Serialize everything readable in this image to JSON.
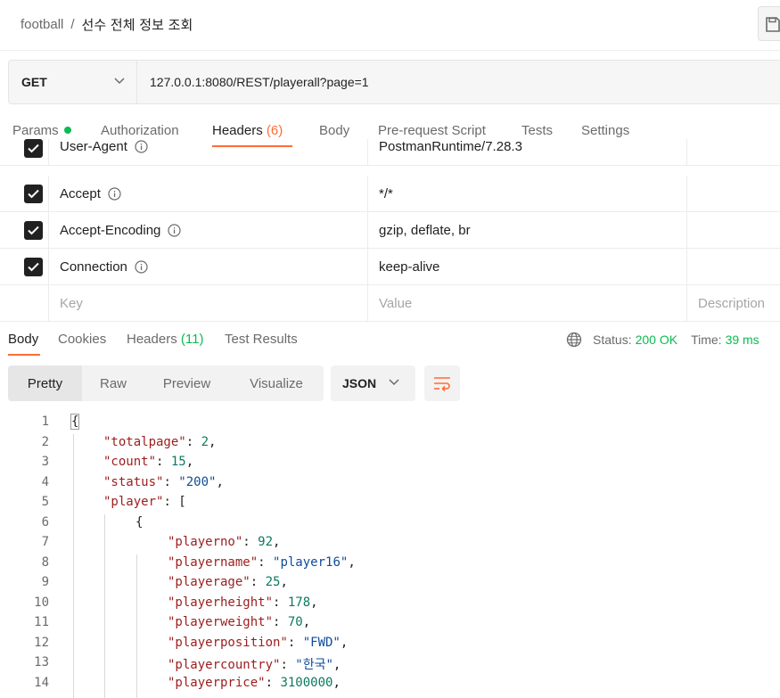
{
  "breadcrumb": {
    "collection": "football",
    "separator": "/",
    "request": "선수 전체 정보 조회"
  },
  "request": {
    "method": "GET",
    "url": "127.0.0.1:8080/REST/playerall?page=1"
  },
  "request_tabs": [
    {
      "label": "Params",
      "count": ""
    },
    {
      "label": "Authorization",
      "count": ""
    },
    {
      "label": "Headers",
      "count": "(6)"
    },
    {
      "label": "Body",
      "count": ""
    },
    {
      "label": "Pre-request Script",
      "count": ""
    },
    {
      "label": "Tests",
      "count": ""
    },
    {
      "label": "Settings",
      "count": ""
    }
  ],
  "headers": [
    {
      "key": "User-Agent",
      "value": "PostmanRuntime/7.28.3"
    },
    {
      "key": "Accept",
      "value": "*/*"
    },
    {
      "key": "Accept-Encoding",
      "value": "gzip, deflate, br"
    },
    {
      "key": "Connection",
      "value": "keep-alive"
    }
  ],
  "headers_placeholder": {
    "key": "Key",
    "value": "Value",
    "description": "Description"
  },
  "response_tabs": [
    {
      "label": "Body",
      "count": ""
    },
    {
      "label": "Cookies",
      "count": ""
    },
    {
      "label": "Headers",
      "count": "(11)"
    },
    {
      "label": "Test Results",
      "count": ""
    }
  ],
  "response_status": {
    "status_label": "Status:",
    "status_value": "200 OK",
    "time_label": "Time:",
    "time_value": "39 ms"
  },
  "view_modes": [
    "Pretty",
    "Raw",
    "Preview",
    "Visualize"
  ],
  "format": "JSON",
  "code_lines": [
    {
      "n": "1",
      "tokens": [
        [
          "p",
          "{"
        ]
      ]
    },
    {
      "n": "2",
      "tokens": [
        [
          "k",
          "\"totalpage\""
        ],
        [
          "p",
          ": "
        ],
        [
          "n",
          "2"
        ],
        [
          "p",
          ","
        ]
      ]
    },
    {
      "n": "3",
      "tokens": [
        [
          "k",
          "\"count\""
        ],
        [
          "p",
          ": "
        ],
        [
          "n",
          "15"
        ],
        [
          "p",
          ","
        ]
      ]
    },
    {
      "n": "4",
      "tokens": [
        [
          "k",
          "\"status\""
        ],
        [
          "p",
          ": "
        ],
        [
          "s",
          "\"200\""
        ],
        [
          "p",
          ","
        ]
      ]
    },
    {
      "n": "5",
      "tokens": [
        [
          "k",
          "\"player\""
        ],
        [
          "p",
          ": ["
        ]
      ]
    },
    {
      "n": "6",
      "tokens": [
        [
          "p",
          "{"
        ]
      ]
    },
    {
      "n": "7",
      "tokens": [
        [
          "k",
          "\"playerno\""
        ],
        [
          "p",
          ": "
        ],
        [
          "n",
          "92"
        ],
        [
          "p",
          ","
        ]
      ]
    },
    {
      "n": "8",
      "tokens": [
        [
          "k",
          "\"playername\""
        ],
        [
          "p",
          ": "
        ],
        [
          "s",
          "\"player16\""
        ],
        [
          "p",
          ","
        ]
      ]
    },
    {
      "n": "9",
      "tokens": [
        [
          "k",
          "\"playerage\""
        ],
        [
          "p",
          ": "
        ],
        [
          "n",
          "25"
        ],
        [
          "p",
          ","
        ]
      ]
    },
    {
      "n": "10",
      "tokens": [
        [
          "k",
          "\"playerheight\""
        ],
        [
          "p",
          ": "
        ],
        [
          "n",
          "178"
        ],
        [
          "p",
          ","
        ]
      ]
    },
    {
      "n": "11",
      "tokens": [
        [
          "k",
          "\"playerweight\""
        ],
        [
          "p",
          ": "
        ],
        [
          "n",
          "70"
        ],
        [
          "p",
          ","
        ]
      ]
    },
    {
      "n": "12",
      "tokens": [
        [
          "k",
          "\"playerposition\""
        ],
        [
          "p",
          ": "
        ],
        [
          "s",
          "\"FWD\""
        ],
        [
          "p",
          ","
        ]
      ]
    },
    {
      "n": "13",
      "tokens": [
        [
          "k",
          "\"playercountry\""
        ],
        [
          "p",
          ": "
        ],
        [
          "s",
          "\"한국\""
        ],
        [
          "p",
          ","
        ]
      ]
    },
    {
      "n": "14",
      "tokens": [
        [
          "k",
          "\"playerprice\""
        ],
        [
          "p",
          ": "
        ],
        [
          "n",
          "3100000"
        ],
        [
          "p",
          ","
        ]
      ]
    }
  ],
  "icons": {
    "save": "save-icon",
    "chevron": "chevron-down-icon",
    "info": "info-icon",
    "globe": "globe-icon",
    "wrap": "wrap-lines-icon",
    "check": "check-icon"
  },
  "colors": {
    "accent": "#ff6c37",
    "success": "#0cbb52",
    "json_key": "#9d1c1c",
    "json_string": "#0f4c9a",
    "json_number": "#0b7a5e"
  }
}
